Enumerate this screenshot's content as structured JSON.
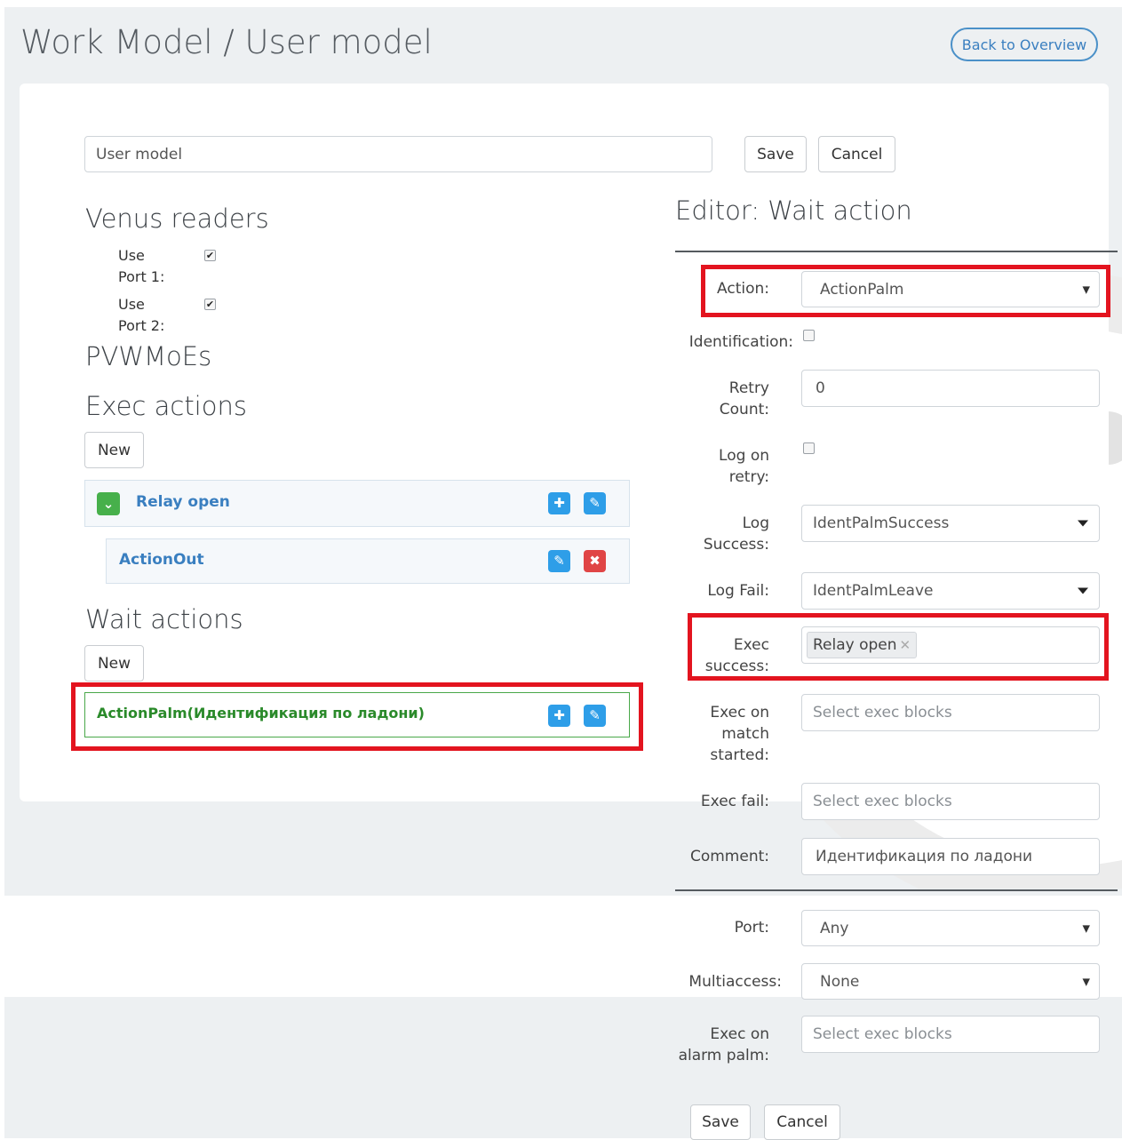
{
  "header": {
    "title": "Work Model / User model",
    "back_label": "Back to Overview"
  },
  "model_form": {
    "name_value": "User model",
    "save_label": "Save",
    "cancel_label": "Cancel"
  },
  "venus_readers": {
    "title": "Venus readers",
    "ports": [
      {
        "label": "Use Port 1:",
        "checked": true
      },
      {
        "label": "Use Port 2:",
        "checked": true
      }
    ]
  },
  "pvwmoes": {
    "title": "PVWMoEs"
  },
  "exec_actions": {
    "title": "Exec actions",
    "new_label": "New",
    "groups": [
      {
        "label": "Relay open",
        "children": [
          {
            "label": "ActionOut"
          }
        ]
      }
    ]
  },
  "wait_actions": {
    "title": "Wait actions",
    "new_label": "New",
    "items": [
      {
        "label": "ActionPalm(Идентификация по ладони)"
      }
    ]
  },
  "editor": {
    "title": "Editor: Wait action",
    "fields": {
      "action": {
        "label": "Action:",
        "value": "ActionPalm"
      },
      "identification": {
        "label": "Identification:",
        "checked": false
      },
      "retry_count": {
        "label": "Retry Count:",
        "value": "0"
      },
      "log_on_retry": {
        "label": "Log on retry:",
        "checked": false
      },
      "log_success": {
        "label": "Log Success:",
        "value": "IdentPalmSuccess"
      },
      "log_fail": {
        "label": "Log Fail:",
        "value": "IdentPalmLeave"
      },
      "exec_success": {
        "label": "Exec success:",
        "tags": [
          "Relay open"
        ]
      },
      "exec_on_match_started": {
        "label": "Exec on match started:",
        "placeholder": "Select exec blocks"
      },
      "exec_fail": {
        "label": "Exec fail:",
        "placeholder": "Select exec blocks"
      },
      "comment": {
        "label": "Comment:",
        "value": "Идентификация по ладони"
      },
      "port": {
        "label": "Port:",
        "value": "Any"
      },
      "multiaccess": {
        "label": "Multiaccess:",
        "value": "None"
      },
      "exec_on_alarm_palm": {
        "label": "Exec on alarm palm:",
        "placeholder": "Select exec blocks"
      }
    },
    "save_label": "Save",
    "cancel_label": "Cancel"
  },
  "colors": {
    "accent": "#3a7fc0",
    "highlight": "#e3141f",
    "success": "#2a8a2a",
    "background": "#edf0f2"
  }
}
